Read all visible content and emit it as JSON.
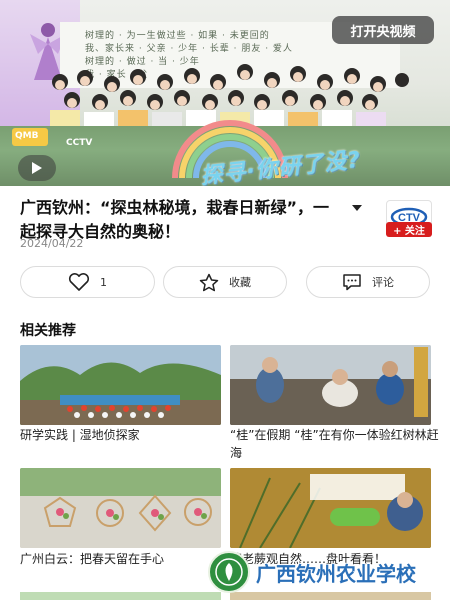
{
  "video": {
    "open_app_button": "打开央视频",
    "banner_text": "探寻·你研了没?",
    "corner_tag": "QMB",
    "channel_mark": "CCTV",
    "wall_lines": [
      "树理的 · 为一生做过些 · 如果 · 未更回的",
      "我、家长来 · 父亲 · 少年 · 长辈 · 朋友 · 爱人",
      "树理的 · 做过 · 当 · 少年",
      "我 · 家长 · 父"
    ]
  },
  "article": {
    "title": "广西钦州：“探虫林秘境，栽春日新绿”，一起探寻大自然的奥秘！",
    "date": "2024/04/22",
    "channel_logo": "CTV",
    "follow_label": "+ 关注"
  },
  "actions": {
    "like_count": "1",
    "favorite_label": "收藏",
    "comment_label": "评论"
  },
  "related": {
    "section_title": "相关推荐",
    "items": [
      {
        "caption": "研学实践 | 湿地侦探家"
      },
      {
        "caption": "“桂”在假期 “桂”在有你一体验红树林赶海"
      },
      {
        "caption": "广州白云：把春天留在手心"
      },
      {
        "caption": "请老蕨观自然……盘叶看看！"
      }
    ]
  },
  "watermark": {
    "text": "广西钦州农业学校"
  }
}
